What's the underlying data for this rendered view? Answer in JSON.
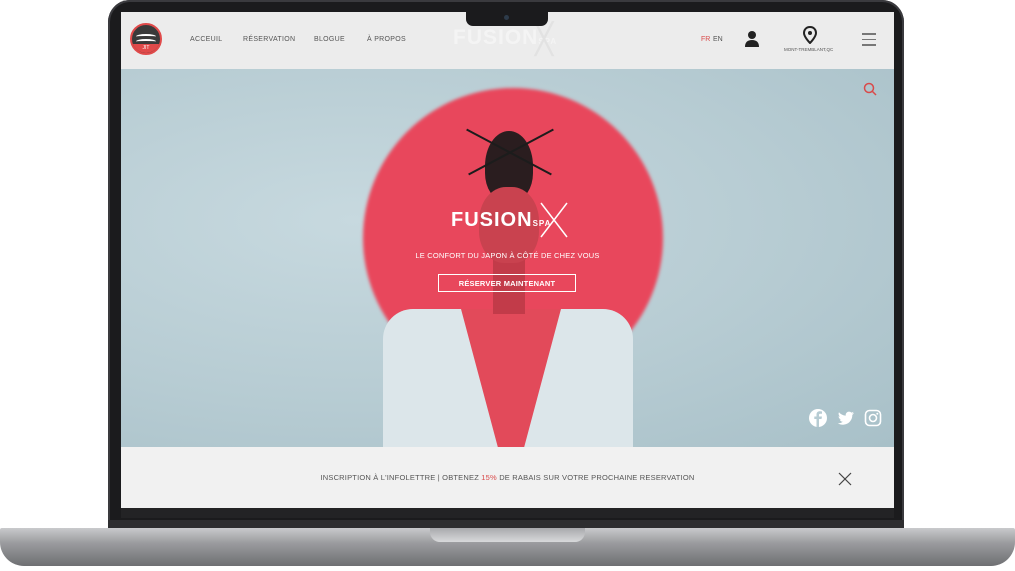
{
  "nav": {
    "logo_text": "JIT",
    "menu": [
      "ACCEUIL",
      "RÉSERVATION",
      "BLOGUE",
      "À PROPOS"
    ],
    "brand": "FUSION",
    "brand_suffix": "SPA",
    "lang_fr": "FR",
    "lang_en": "EN",
    "location": "MONT-TREMBLANT,QC"
  },
  "hero": {
    "brand": "FUSION",
    "brand_suffix": "SPA",
    "tagline": "LE CONFORT DU JAPON À CÔTÉ DE CHEZ VOUS",
    "cta": "RÉSERVER MAINTENANT"
  },
  "newsletter": {
    "text_before": "INSCRIPTION À L'INFOLETTRE | OBTENEZ ",
    "highlight": "15%",
    "text_after": " DE RABAIS SUR VOTRE PROCHAINE RESERVATION"
  },
  "icons": [
    "user-icon",
    "location-pin-icon",
    "menu-icon",
    "search-icon",
    "facebook-icon",
    "twitter-icon",
    "instagram-icon",
    "close-icon"
  ],
  "colors": {
    "accent": "#d94a4a",
    "sun": "#e8475c",
    "hero_bg": "#b7ccd3"
  }
}
